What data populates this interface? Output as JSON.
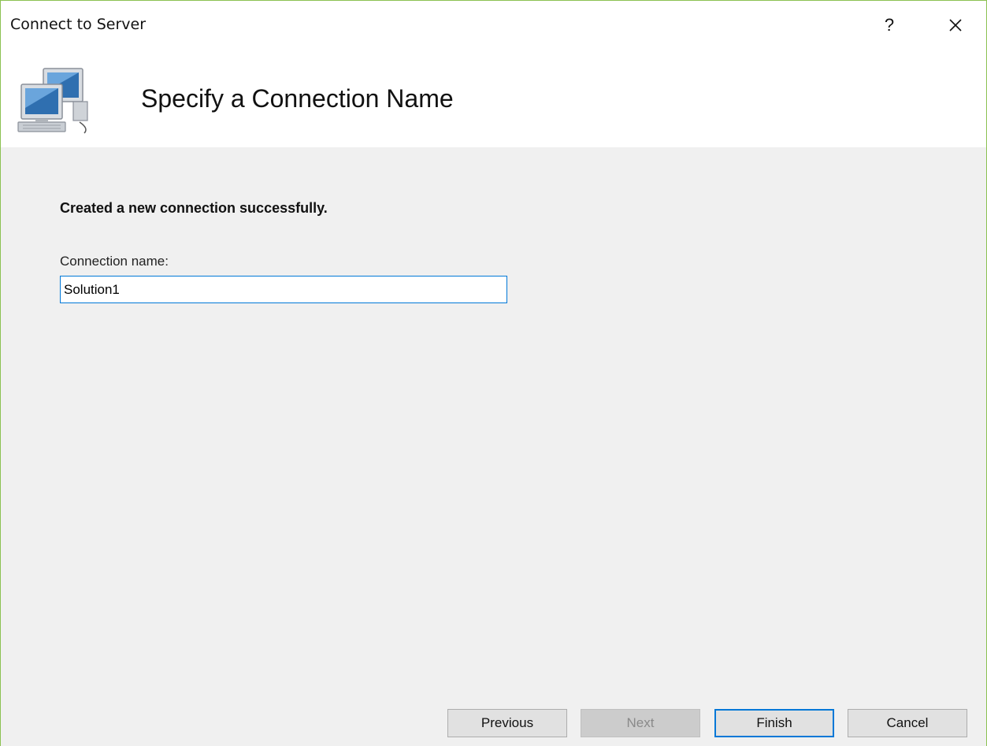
{
  "window": {
    "title": "Connect to Server",
    "help_label": "?",
    "close_icon": "close-icon"
  },
  "header": {
    "icon": "network-computers-icon",
    "title": "Specify a Connection Name"
  },
  "content": {
    "status_message": "Created a new connection successfully.",
    "connection_name_label": "Connection name:",
    "connection_name_value": "Solution1"
  },
  "buttons": {
    "previous": "Previous",
    "next": "Next",
    "finish": "Finish",
    "cancel": "Cancel"
  },
  "colors": {
    "window_border": "#8cc152",
    "accent": "#0078d7",
    "panel_bg": "#f0f0f0"
  }
}
